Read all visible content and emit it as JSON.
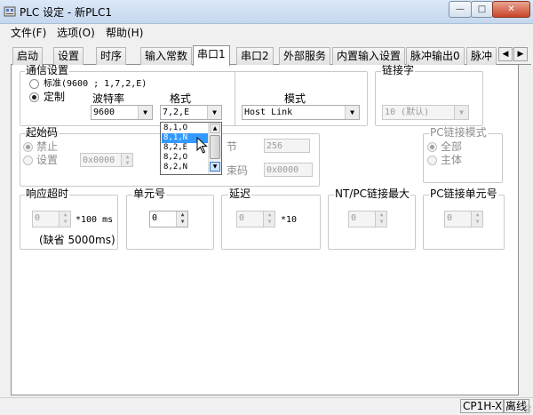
{
  "window": {
    "title": "PLC 设定 - 新PLC1",
    "min": "—",
    "max": "□",
    "close": "✕"
  },
  "menu": [
    "文件(F)",
    "选项(O)",
    "帮助(H)"
  ],
  "tabs": [
    "启动",
    "设置",
    "时序",
    "输入常数",
    "串口1",
    "串口2",
    "外部服务",
    "内置输入设置",
    "脉冲输出0",
    "脉冲"
  ],
  "tab_scroll": {
    "left": "◀",
    "right": "▶"
  },
  "comm": {
    "label": "通信设置",
    "standard": "标准(9600 ; 1,7,2,E)",
    "custom": "定制",
    "baud_label": "波特率",
    "baud_value": "9600",
    "format_label": "格式",
    "format_value": "7,2,E",
    "mode_label": "模式",
    "mode_value": "Host Link"
  },
  "format_dropdown": {
    "options": [
      "8,1,O",
      "8,1,N",
      "8,2,E",
      "8,2,O",
      "8,2,N"
    ],
    "selected": 1
  },
  "link_words": {
    "label": "链接字",
    "value": "10 (默认)"
  },
  "start_code": {
    "label": "起始码",
    "disable": "禁止",
    "set": "设置",
    "set_value": "0x0000",
    "bytes_label": "节",
    "bytes_value": "256",
    "end_label": "束码",
    "end_value": "0x0000"
  },
  "pc_link_mode": {
    "label": "PC链接模式",
    "all": "全部",
    "master": "主体"
  },
  "response_timeout": {
    "label": "响应超时",
    "value": "0",
    "unit": "*100 ms",
    "default": "(缺省 5000ms)"
  },
  "unit_no": {
    "label": "单元号",
    "value": "0"
  },
  "delay": {
    "label": "延迟",
    "value": "0",
    "unit": "*10"
  },
  "nt_pc_max": {
    "label": "NT/PC链接最大",
    "value": "0"
  },
  "pc_link_unit": {
    "label": "PC链接单元号",
    "value": "0"
  },
  "status": {
    "model": "CP1H-X",
    "state": "离线"
  },
  "colors": {
    "selection": "#3399ff",
    "border": "#8e8f8f"
  }
}
